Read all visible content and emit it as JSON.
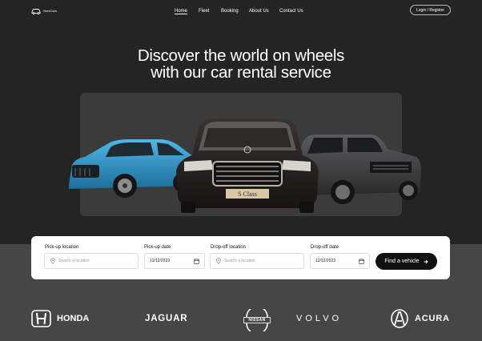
{
  "header": {
    "logo_text": "RentCars",
    "nav": [
      {
        "label": "Home",
        "active": true
      },
      {
        "label": "Fleet"
      },
      {
        "label": "Booking"
      },
      {
        "label": "About Us"
      },
      {
        "label": "Contact Us"
      }
    ],
    "login_label": "Login / Register"
  },
  "hero": {
    "headline_line1": "Discover the world on wheels",
    "headline_line2": "with our car rental service",
    "plate_text": "S Class"
  },
  "search": {
    "pickup_location_label": "Pick-up location",
    "pickup_location_placeholder": "Search a location",
    "pickup_date_label": "Pick-up date",
    "pickup_date_value": "12/12/2023",
    "dropoff_location_label": "Drop-off location",
    "dropoff_location_placeholder": "Search a location",
    "dropoff_date_label": "Drop-off date",
    "dropoff_date_value": "12/12/2023",
    "find_label": "Find a vehicle"
  },
  "brands": {
    "honda": "HONDA",
    "jaguar": "JAGUAR",
    "nissan": "NISSAN",
    "volvo": "VOLVO",
    "acura": "ACURA"
  },
  "colors": {
    "hero_bg": "#242424",
    "lower_bg": "#464646",
    "button_bg": "#111111",
    "card_bg": "#ffffff"
  },
  "icons": [
    "car-logo-icon",
    "map-pin-icon",
    "calendar-icon",
    "arrow-right-icon"
  ]
}
